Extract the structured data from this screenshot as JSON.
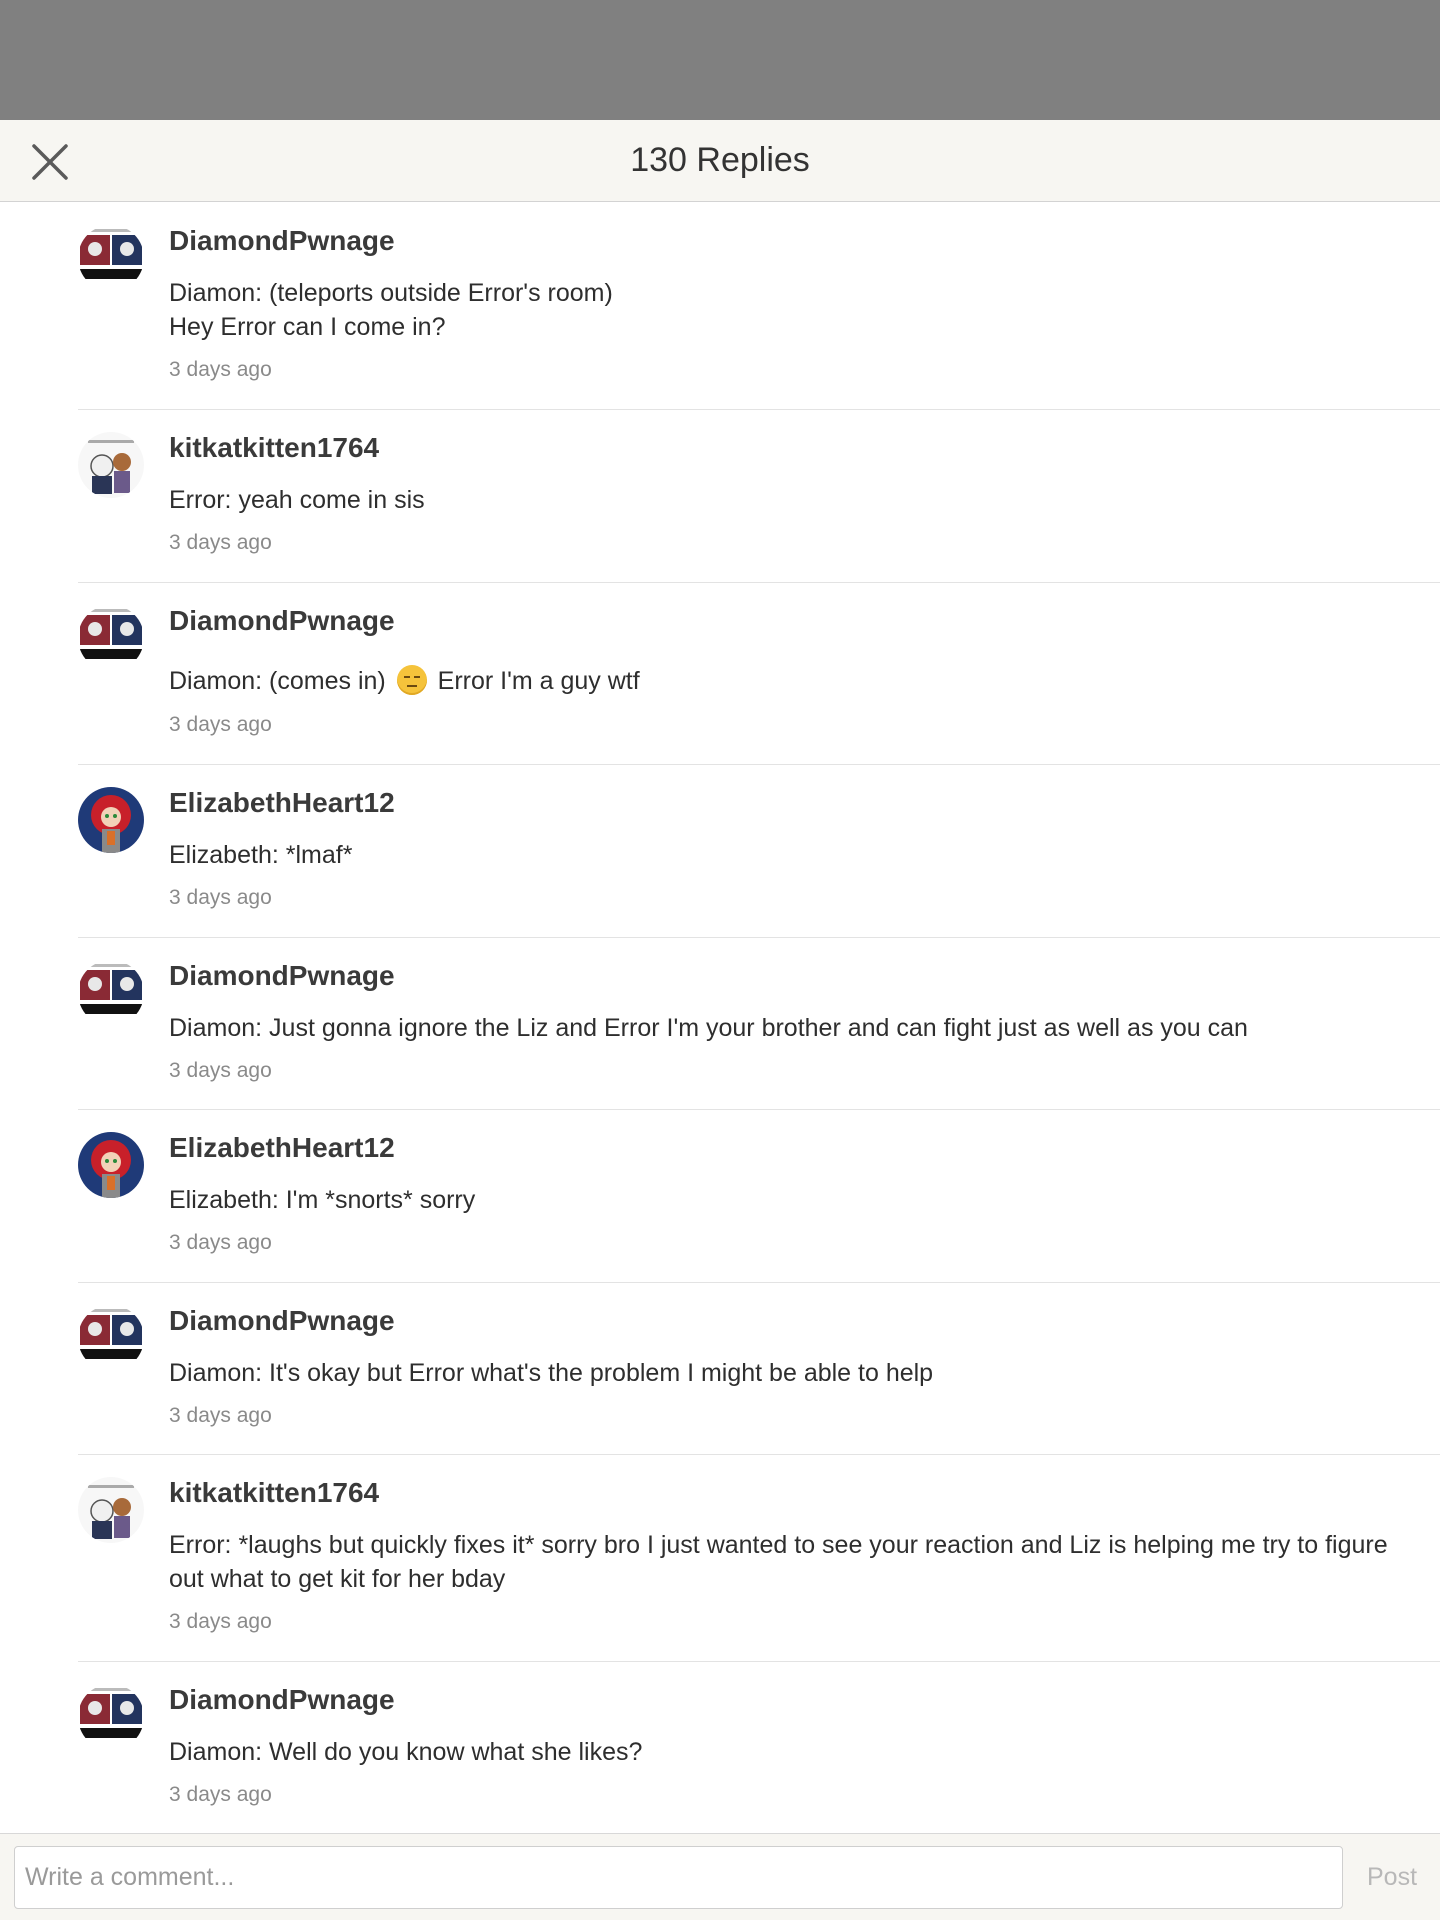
{
  "header": {
    "title": "130 Replies",
    "close_icon": "close-icon"
  },
  "replies": [
    {
      "username": "DiamondPwnage",
      "lines": [
        "Diamon: (teleports outside Error's room)",
        "Hey Error can I come in?"
      ],
      "time": "3 days ago"
    },
    {
      "username": "kitkatkitten1764",
      "lines": [
        "Error: yeah come in sis"
      ],
      "time": "3 days ago"
    },
    {
      "username": "DiamondPwnage",
      "lines": [
        "Diamon: (comes in)",
        "Error I'm a guy wtf"
      ],
      "emoji": "expressionless-face-emoji",
      "time": "3 days ago"
    },
    {
      "username": "ElizabethHeart12",
      "lines": [
        "Elizabeth: *lmaf*"
      ],
      "time": "3 days ago"
    },
    {
      "username": "DiamondPwnage",
      "lines": [
        "Diamon: Just gonna ignore the Liz and Error I'm your brother and can fight just as well as you can"
      ],
      "time": "3 days ago"
    },
    {
      "username": "ElizabethHeart12",
      "lines": [
        "Elizabeth: I'm *snorts* sorry"
      ],
      "time": "3 days ago"
    },
    {
      "username": "DiamondPwnage",
      "lines": [
        "Diamon: It's okay but Error what's the problem I might be able to help"
      ],
      "time": "3 days ago"
    },
    {
      "username": "kitkatkitten1764",
      "lines": [
        "Error: *laughs but quickly fixes it* sorry bro I just wanted to see your reaction and Liz is helping me try to figure out what to get kit for her bday"
      ],
      "time": "3 days ago"
    },
    {
      "username": "DiamondPwnage",
      "lines": [
        "Diamon: Well do you know what she likes?"
      ],
      "time": "3 days ago"
    }
  ],
  "footer": {
    "placeholder": "Write a comment...",
    "post_label": "Post"
  },
  "colors": {
    "top_bar": "#808080",
    "header_bg": "#f7f6f2",
    "muted_text": "#8a8a8a"
  }
}
